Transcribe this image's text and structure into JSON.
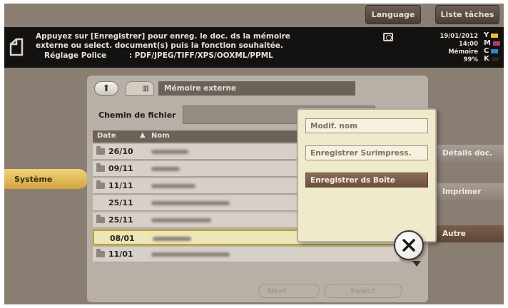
{
  "header": {
    "language_label": "Language",
    "tasks_label": "Liste tâches"
  },
  "message": {
    "line1": "Appuyez sur [Enregistrer] pour enreg. le doc. ds la mémoire",
    "line2": "externe ou select. document(s) puis la fonction souhaitée.",
    "line3_label": "Réglage Police",
    "line3_value": ": PDF/JPEG/TIFF/XPS/OOXML/PPML"
  },
  "status": {
    "date": "19/01/2012",
    "time": "14:00",
    "memory_label": "Mémoire",
    "memory_value": "99%",
    "toner": [
      {
        "letter": "Y",
        "color": "#e8c22a"
      },
      {
        "letter": "M",
        "color": "#c2307a"
      },
      {
        "letter": "C",
        "color": "#2a8ac8"
      },
      {
        "letter": "K",
        "color": "#262626"
      }
    ]
  },
  "left_menu": {
    "systeme_label": "Système"
  },
  "browser": {
    "path_label": "Mémoire externe",
    "chemin_label": "Chemin de fichier",
    "col_date": "Date",
    "col_sort": "▲",
    "col_name": "Nom",
    "rows": [
      {
        "date": "26/10",
        "folder": true,
        "selected": false
      },
      {
        "date": "09/11",
        "folder": true,
        "selected": false
      },
      {
        "date": "11/11",
        "folder": true,
        "selected": false
      },
      {
        "date": "25/11",
        "folder": false,
        "selected": false
      },
      {
        "date": "25/11",
        "folder": true,
        "selected": false
      },
      {
        "date": "08/01",
        "folder": false,
        "selected": true
      },
      {
        "date": "11/01",
        "folder": true,
        "selected": false
      }
    ],
    "next_label": "Next",
    "select_label": "Select"
  },
  "side_buttons": {
    "details_label": "Détails doc.",
    "print_label": "Imprimer",
    "other_label": "Autre"
  },
  "popup": {
    "rename_label": "Modif. nom",
    "overlay_label": "Enregistrer Surimpress.",
    "save_box_label": "Enregistrer ds Boîte"
  },
  "colors": {
    "accent_gold": "#d2a43e",
    "popup_primary": "#6b503e"
  }
}
